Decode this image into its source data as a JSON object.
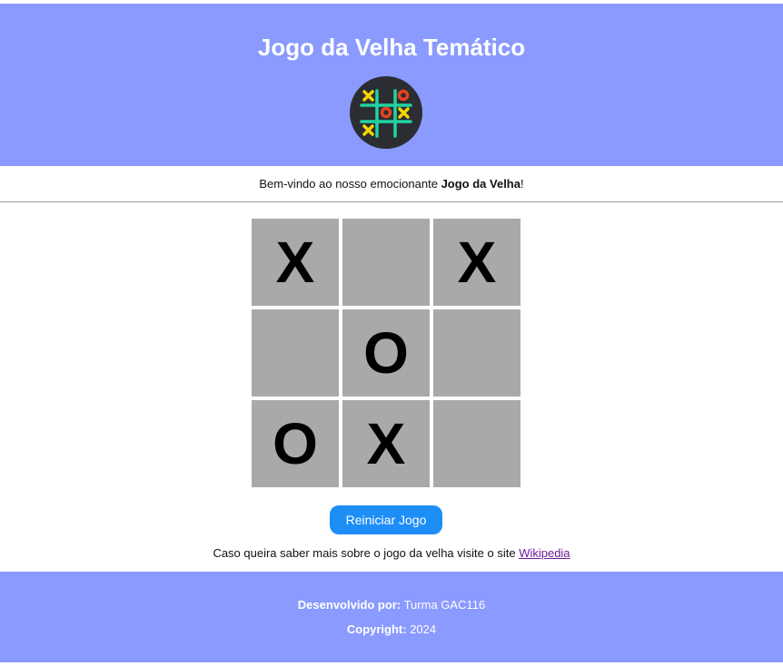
{
  "header": {
    "title": "Jogo da Velha Temático",
    "logo_icon": "tic-tac-toe-logo-icon"
  },
  "welcome": {
    "prefix": "Bem-vindo ao nosso emocionante ",
    "emphasis": "Jogo da Velha",
    "suffix": "!"
  },
  "board": {
    "cells": [
      "X",
      "",
      "X",
      "",
      "O",
      "",
      "O",
      "X",
      ""
    ]
  },
  "actions": {
    "restart_label": "Reiniciar Jogo"
  },
  "info": {
    "text": "Caso queira saber mais sobre o jogo da velha visite o site ",
    "link_label": "Wikipedia"
  },
  "footer": {
    "developed_label": "Desenvolvido por:",
    "developed_value": " Turma GAC116",
    "copyright_label": "Copyright:",
    "copyright_value": " 2024"
  },
  "colors": {
    "header_bg": "#8a9afe",
    "cell_bg": "#a9a9a9",
    "button_bg": "#1e8ef7"
  }
}
